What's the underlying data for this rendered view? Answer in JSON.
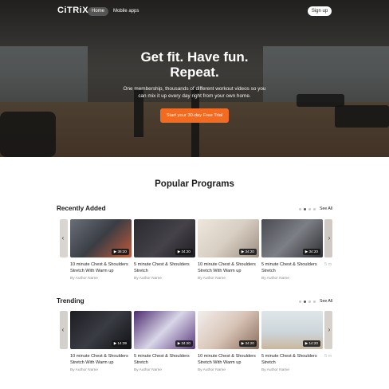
{
  "nav": {
    "logo": "CiTRiX",
    "home": "Home",
    "mobile_apps": "Mobile apps",
    "signup": "Sign up"
  },
  "hero": {
    "title": "Get fit. Have fun. Repeat.",
    "subtitle": "One membership, thousands of different workout videos so you can mix it up every day right from your own home.",
    "cta": "Start your 30-day Free Trial"
  },
  "programs": {
    "title": "Popular Programs"
  },
  "colors": {
    "accent": "#f36b21"
  },
  "recently_added": {
    "title": "Recently Added",
    "see_all": "See All",
    "dots": {
      "count": 4,
      "active": 1
    },
    "left_arrow_icon": "chevron-left",
    "right_arrow_icon": "chevron-right",
    "edge_left_text": ".",
    "edge_right_title": "5 mi Str",
    "edge_right_author": "By",
    "cards": [
      {
        "duration": "▶ 38:20",
        "title": "10 minute Chest & Shoulders Stretch With Warm up",
        "author": "By Author Name"
      },
      {
        "duration": "▶ 34:20",
        "title": "5 minute Chest & Shoulders Stretch",
        "author": "By Author Name"
      },
      {
        "duration": "▶ 34:20",
        "title": "10 minute Chest & Shoulders Stretch With Warm up",
        "author": "By Author Name"
      },
      {
        "duration": "▶ 34:20",
        "title": "5 minute Chest & Shoulders Stretch",
        "author": "By Author Name"
      }
    ]
  },
  "trending": {
    "title": "Trending",
    "see_all": "See All",
    "dots": {
      "count": 4,
      "active": 1
    },
    "left_arrow_icon": "chevron-left",
    "right_arrow_icon": "chevron-right",
    "edge_left_text": ".",
    "edge_right_title": "5 mi Str",
    "edge_right_author": "By",
    "cards": [
      {
        "duration": "▶ 14:39",
        "title": "10 minute Chest & Shoulders Stretch With Warm up",
        "author": "By Author Name"
      },
      {
        "duration": "▶ 34:20",
        "title": "5 minute Chest & Shoulders Stretch",
        "author": "By Author Name"
      },
      {
        "duration": "▶ 34:20",
        "title": "10 minute Chest & Shoulders Stretch With Warm up",
        "author": "By Author Name"
      },
      {
        "duration": "▶ 14:20",
        "title": "5 minute Chest & Shoulders Stretch",
        "author": "By Author Name"
      }
    ]
  }
}
